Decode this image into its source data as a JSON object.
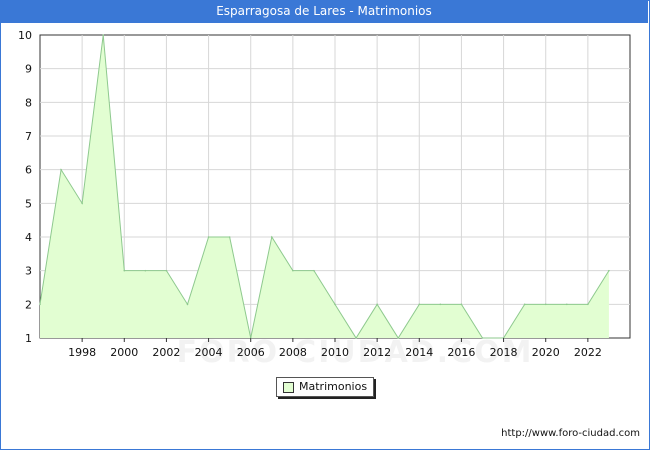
{
  "chart_data": {
    "type": "area",
    "title": "Esparragosa de Lares - Matrimonios",
    "xlabel": "",
    "ylabel": "",
    "x": [
      1996,
      1997,
      1998,
      1999,
      2000,
      2001,
      2002,
      2003,
      2004,
      2005,
      2006,
      2007,
      2008,
      2009,
      2010,
      2011,
      2012,
      2013,
      2014,
      2015,
      2016,
      2017,
      2018,
      2019,
      2020,
      2021,
      2022,
      2023
    ],
    "series": [
      {
        "name": "Matrimonios",
        "values": [
          2,
          6,
          5,
          10,
          3,
          3,
          3,
          2,
          4,
          4,
          1,
          4,
          3,
          3,
          2,
          1,
          2,
          1,
          2,
          2,
          2,
          1,
          1,
          2,
          2,
          2,
          2,
          3
        ]
      }
    ],
    "xticks": [
      "1998",
      "2000",
      "2002",
      "2004",
      "2006",
      "2008",
      "2010",
      "2012",
      "2014",
      "2016",
      "2018",
      "2020",
      "2022"
    ],
    "yticks": [
      "1",
      "2",
      "3",
      "4",
      "5",
      "6",
      "7",
      "8",
      "9",
      "10"
    ],
    "xlim": [
      1996,
      2024
    ],
    "ylim": [
      1,
      10
    ],
    "grid": true,
    "legend": "bottom-center",
    "colors": {
      "fill": "#e2fed2",
      "line": "#8ec98e",
      "grid": "#d7d7d7",
      "header": "#3a78d6"
    },
    "watermark": "FORO-CIUDAD.COM",
    "source": "http://www.foro-ciudad.com"
  }
}
